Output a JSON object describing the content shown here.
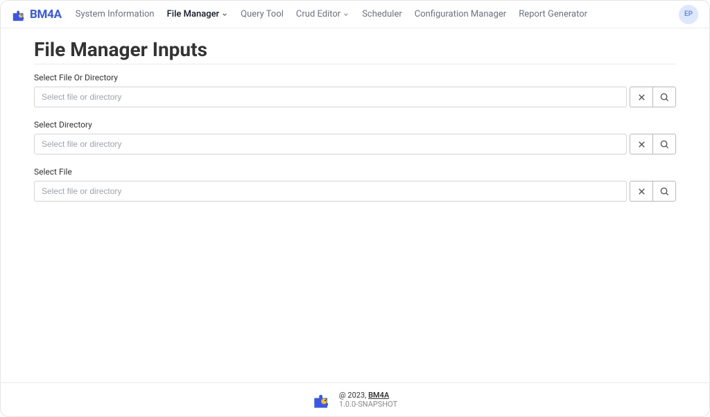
{
  "brand": {
    "name": "BM4A"
  },
  "nav": {
    "items": [
      {
        "label": "System Information",
        "hasDropdown": false,
        "active": false
      },
      {
        "label": "File Manager",
        "hasDropdown": true,
        "active": true
      },
      {
        "label": "Query Tool",
        "hasDropdown": false,
        "active": false
      },
      {
        "label": "Crud Editor",
        "hasDropdown": true,
        "active": false
      },
      {
        "label": "Scheduler",
        "hasDropdown": false,
        "active": false
      },
      {
        "label": "Configuration Manager",
        "hasDropdown": false,
        "active": false
      },
      {
        "label": "Report Generator",
        "hasDropdown": false,
        "active": false
      }
    ]
  },
  "user": {
    "initials": "EP"
  },
  "page": {
    "title": "File Manager Inputs"
  },
  "fields": [
    {
      "label": "Select File Or Directory",
      "placeholder": "Select file or directory",
      "value": ""
    },
    {
      "label": "Select Directory",
      "placeholder": "Select file or directory",
      "value": ""
    },
    {
      "label": "Select File",
      "placeholder": "Select file or directory",
      "value": ""
    }
  ],
  "footer": {
    "copyright": "@ 2023, ",
    "link": "BM4A",
    "version": "1.0.0-SNAPSHOT"
  }
}
